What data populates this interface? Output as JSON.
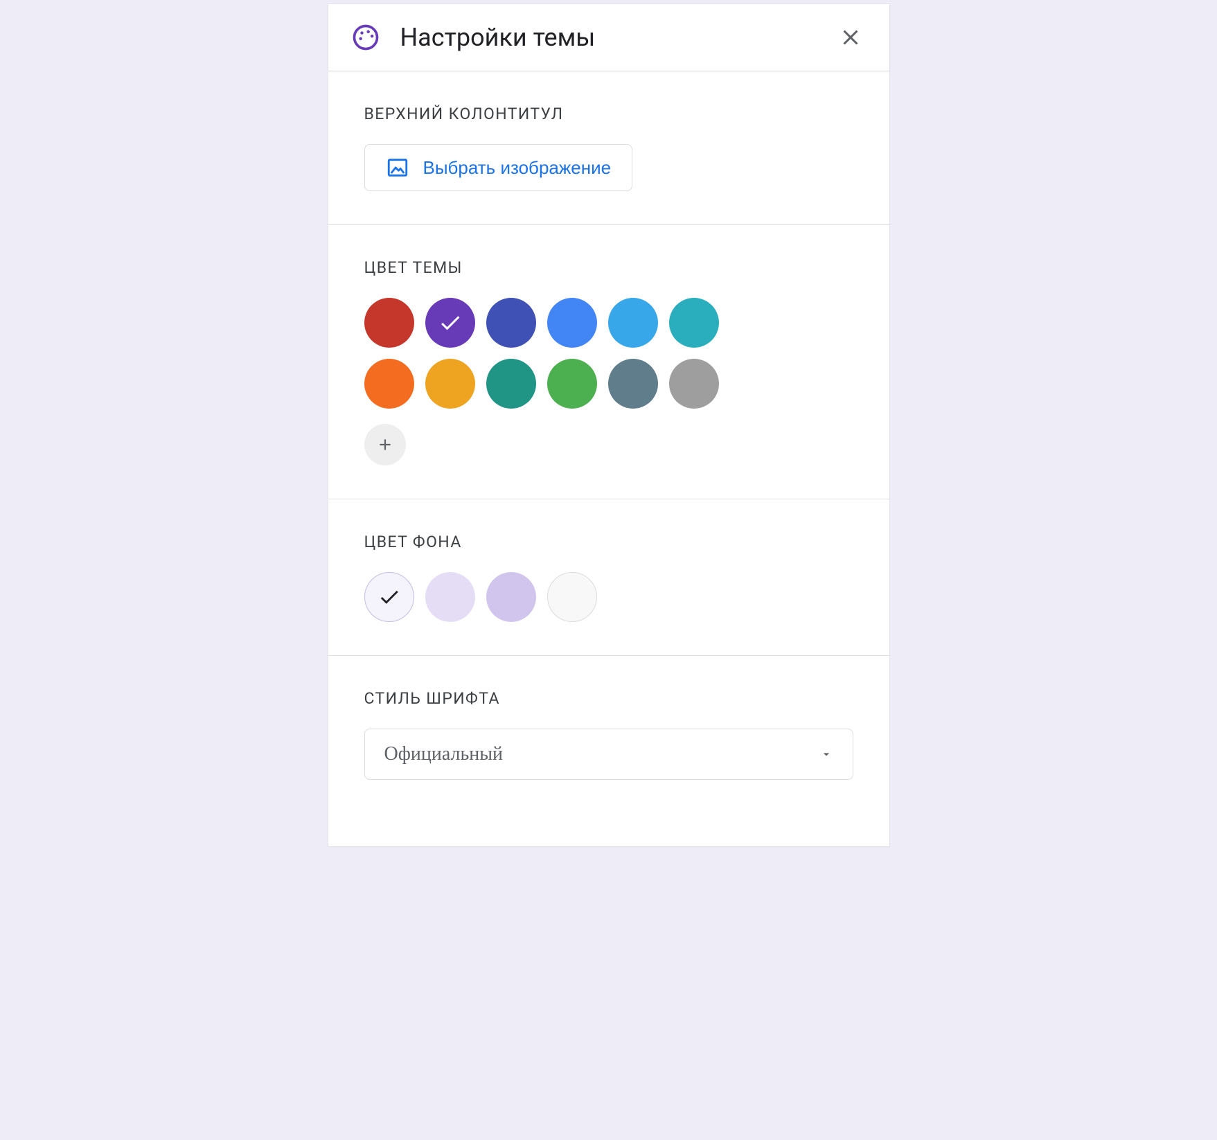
{
  "header": {
    "title": "Настройки темы"
  },
  "sections": {
    "header_image": {
      "label": "ВЕРХНИЙ КОЛОНТИТУЛ",
      "choose_button": "Выбрать изображение"
    },
    "theme_color": {
      "label": "ЦВЕТ ТЕМЫ",
      "colors": [
        {
          "hex": "#c5362b",
          "selected": false
        },
        {
          "hex": "#673ab7",
          "selected": true
        },
        {
          "hex": "#3f51b5",
          "selected": false
        },
        {
          "hex": "#4285f4",
          "selected": false
        },
        {
          "hex": "#37a7ea",
          "selected": false
        },
        {
          "hex": "#2aaebd",
          "selected": false
        },
        {
          "hex": "#f36c20",
          "selected": false
        },
        {
          "hex": "#eea321",
          "selected": false
        },
        {
          "hex": "#209586",
          "selected": false
        },
        {
          "hex": "#4caf50",
          "selected": false
        },
        {
          "hex": "#607d8b",
          "selected": false
        },
        {
          "hex": "#9e9e9e",
          "selected": false
        }
      ]
    },
    "background_color": {
      "label": "ЦВЕТ ФОНА",
      "colors": [
        {
          "hex": "#f5f3fc",
          "selected": true,
          "outline": false
        },
        {
          "hex": "#e4ddf5",
          "selected": false,
          "outline": false
        },
        {
          "hex": "#d2c5ed",
          "selected": false,
          "outline": false
        },
        {
          "hex": "#f8f8f8",
          "selected": false,
          "outline": true
        }
      ]
    },
    "font_style": {
      "label": "СТИЛЬ ШРИФТА",
      "selected": "Официальный"
    }
  }
}
